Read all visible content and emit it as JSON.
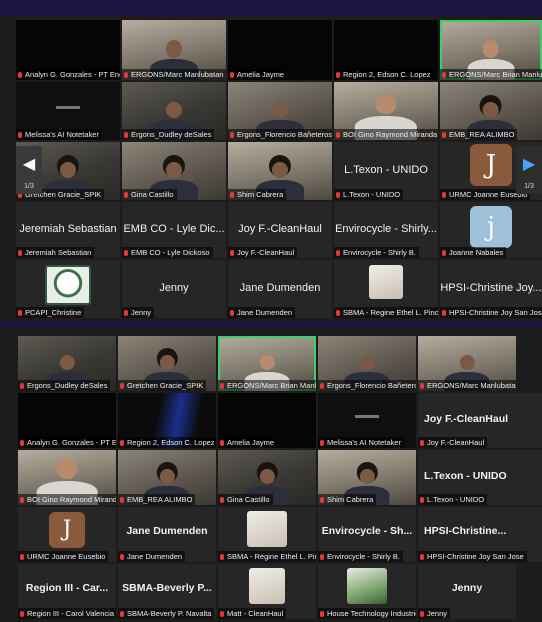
{
  "meeting": {
    "top": {
      "row1": [
        {
          "name": "Analyn G. Gonzales - PT Energ..."
        },
        {
          "name": "ERGONS/Marc Manlubatan"
        },
        {
          "name": "Amelia Jayme"
        },
        {
          "name": "Region 2, Edson C. Lopez"
        },
        {
          "name": "ERGONS/Marc Brian Manlubatan"
        }
      ],
      "row2": [
        {
          "name": "Melissa's AI Notetaker"
        },
        {
          "name": "Ergons_Dudley deSales"
        },
        {
          "name": "Ergons_Florencio Bañeteros, Jr."
        },
        {
          "name": "BOI Gino Raymond Miranda"
        },
        {
          "name": "EMB_REA ALIMBO"
        }
      ],
      "row3": [
        {
          "name": "Gretchen Gracie_SPIK"
        },
        {
          "name": "Gina Castillo"
        },
        {
          "name": "Shim Cabrera"
        },
        {
          "display": "L.Texon - UNIDO",
          "name": "L.Texon - UNIDO"
        },
        {
          "initial": "J",
          "name": "URMC Joanne Eusebio"
        }
      ],
      "row4": [
        {
          "display": "Jeremiah Sebastian",
          "name": "Jeremiah Sebastian"
        },
        {
          "display": "EMB CO - Lyle Dic...",
          "name": "EMB CO - Lyle Dickoso"
        },
        {
          "display": "Joy F.-CleanHaul",
          "name": "Joy F.-CleanHaul"
        },
        {
          "display": "Envirocycle - Shirly...",
          "name": "Envirocycle - Shirly B."
        },
        {
          "initial": "j",
          "name": "Joanne Nabales"
        }
      ],
      "row5": [
        {
          "name": "PCAPI_Christine"
        },
        {
          "display": "Jenny",
          "name": "Jenny"
        },
        {
          "display": "Jane Dumenden",
          "name": "Jane Dumenden"
        },
        {
          "name": "SBMA - Regine Ethel L. Pinoli"
        },
        {
          "display": "HPSI-Christine Joy...",
          "name": "HPSI-Christine Joy San Jose"
        }
      ],
      "page_left": "1/3",
      "page_right": "1/3"
    },
    "bottom": {
      "row1": [
        {
          "name": "Ergons_Dudley deSales"
        },
        {
          "name": "Gretchen Gracie_SPIK"
        },
        {
          "name": "ERGONS/Marc Brian Manlubatan"
        },
        {
          "name": "Ergons_Florencio Bañeteros..."
        },
        {
          "name": "ERGONS/Marc Manlubatan"
        }
      ],
      "row2": [
        {
          "name": "Analyn G. Gonzales - PT Ene..."
        },
        {
          "name": "Region 2, Edson C. Lopez"
        },
        {
          "name": "Amelia Jayme"
        },
        {
          "name": "Melissa's AI Notetaker"
        },
        {
          "display": "Joy F.-CleanHaul",
          "name": "Joy F.-CleanHaul"
        }
      ],
      "row3": [
        {
          "name": "BOI Gino Raymond Miranda"
        },
        {
          "name": "EMB_REA ALIMBO"
        },
        {
          "name": "Gina Castillo"
        },
        {
          "name": "Shim Cabrera"
        },
        {
          "display": "L.Texon - UNIDO",
          "name": "L.Texon - UNIDO"
        }
      ],
      "row4": [
        {
          "initial": "J",
          "name": "URMC Joanne Eusebio"
        },
        {
          "display": "Jane Dumenden",
          "name": "Jane Dumenden"
        },
        {
          "name": "SBMA - Regine Ethel L. Pinoli"
        },
        {
          "display": "Envirocycle - Sh...",
          "name": "Envirocycle - Shirly B."
        },
        {
          "display": "HPSI-Christine...",
          "name": "HPSI-Christine Joy San Jose"
        }
      ],
      "row5": [
        {
          "display": "Region III - Car...",
          "name": "Region III - Carol Valencia -..."
        },
        {
          "display": "SBMA-Beverly P...",
          "name": "SBMA-Beverly P. Navalta"
        },
        {
          "name": "Matt - CleanHaul"
        },
        {
          "name": "House Technology Industrie..."
        },
        {
          "display": "Jenny",
          "name": "Jenny"
        }
      ]
    }
  },
  "colors": {
    "active_speaker": "#3ccf6a",
    "mic_muted": "#e03a3a",
    "page_bg": "#1b1740",
    "gallery_bg": "#1c1c1c"
  }
}
